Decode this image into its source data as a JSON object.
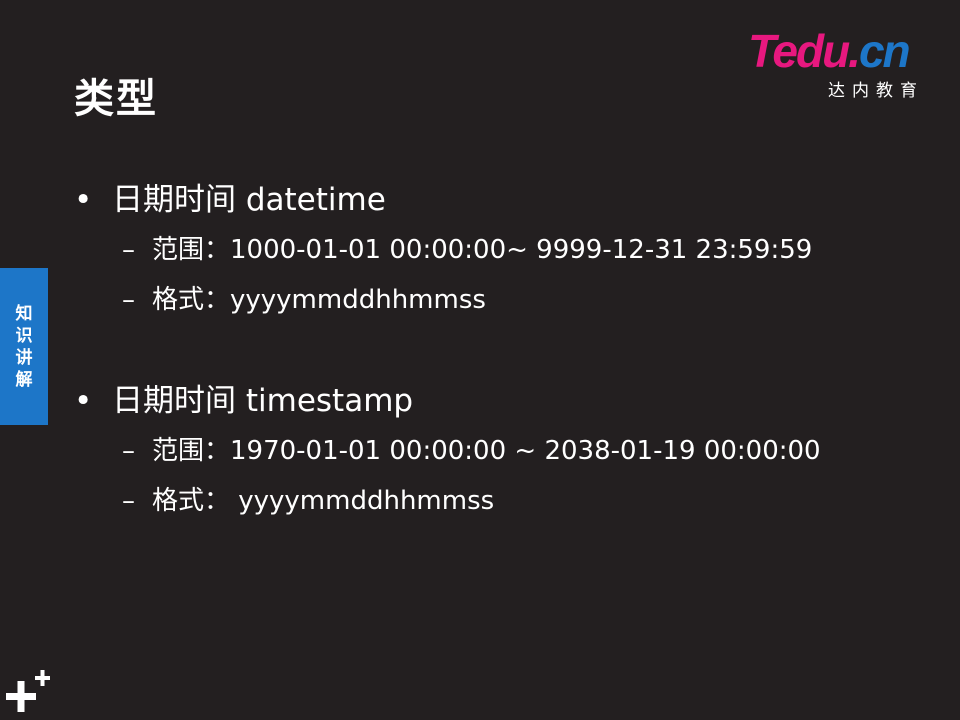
{
  "slide": {
    "title": "类型"
  },
  "logo": {
    "brand_t": "T",
    "brand_edu": "edu.",
    "brand_cn": "cn",
    "subtitle": "达内教育"
  },
  "side_tab": {
    "chars": [
      "知",
      "识",
      "讲",
      "解"
    ]
  },
  "sections": [
    {
      "bullet": "•",
      "heading": "日期时间 datetime",
      "items": [
        {
          "dash": "–",
          "text": "范围：1000-01-01 00:00:00~ 9999-12-31  23:59:59"
        },
        {
          "dash": "–",
          "text": "格式：yyyymmddhhmmss"
        }
      ]
    },
    {
      "bullet": "•",
      "heading": "日期时间 timestamp",
      "items": [
        {
          "dash": "–",
          "text": "范围：1970-01-01  00:00:00 ~ 2038-01-19  00:00:00"
        },
        {
          "dash": "–",
          "text": "格式： yyyymmddhhmmss"
        }
      ]
    }
  ],
  "colors": {
    "background": "#231f20",
    "accent_blue": "#1d76c8",
    "brand_pink": "#e7187f"
  }
}
